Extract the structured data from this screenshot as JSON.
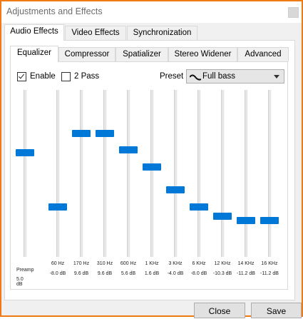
{
  "window": {
    "title": "Adjustments and Effects"
  },
  "tabs": [
    {
      "label": "Audio Effects",
      "active": true
    },
    {
      "label": "Video Effects",
      "active": false
    },
    {
      "label": "Synchronization",
      "active": false
    }
  ],
  "subtabs": [
    {
      "label": "Equalizer",
      "active": true
    },
    {
      "label": "Compressor",
      "active": false
    },
    {
      "label": "Spatializer",
      "active": false
    },
    {
      "label": "Stereo Widener",
      "active": false
    },
    {
      "label": "Advanced",
      "active": false
    }
  ],
  "equalizer": {
    "enable": {
      "label": "Enable",
      "checked": true
    },
    "two_pass": {
      "label": "2 Pass",
      "checked": false
    },
    "preset": {
      "label": "Preset",
      "value": "Full bass"
    },
    "preamp": {
      "label": "Preamp",
      "value_text": "5.0 dB",
      "value": 5.0
    },
    "range_db": [
      -20,
      20
    ],
    "bands": [
      {
        "freq": "60 Hz",
        "value_text": "-8.0 dB",
        "value": -8.0
      },
      {
        "freq": "170 Hz",
        "value_text": "9.6 dB",
        "value": 9.6
      },
      {
        "freq": "310 Hz",
        "value_text": "9.6 dB",
        "value": 9.6
      },
      {
        "freq": "600 Hz",
        "value_text": "5.6 dB",
        "value": 5.6
      },
      {
        "freq": "1 KHz",
        "value_text": "1.6 dB",
        "value": 1.6
      },
      {
        "freq": "3 KHz",
        "value_text": "-4.0 dB",
        "value": -4.0
      },
      {
        "freq": "6 KHz",
        "value_text": "-8.0 dB",
        "value": -8.0
      },
      {
        "freq": "12 KHz",
        "value_text": "-10.3 dB",
        "value": -10.3
      },
      {
        "freq": "14 KHz",
        "value_text": "-11.2 dB",
        "value": -11.2
      },
      {
        "freq": "16 KHz",
        "value_text": "-11.2 dB",
        "value": -11.2
      }
    ]
  },
  "buttons": {
    "close": "Close",
    "save": "Save"
  },
  "colors": {
    "accent": "#0078d7",
    "window_border": "#f07a12"
  }
}
